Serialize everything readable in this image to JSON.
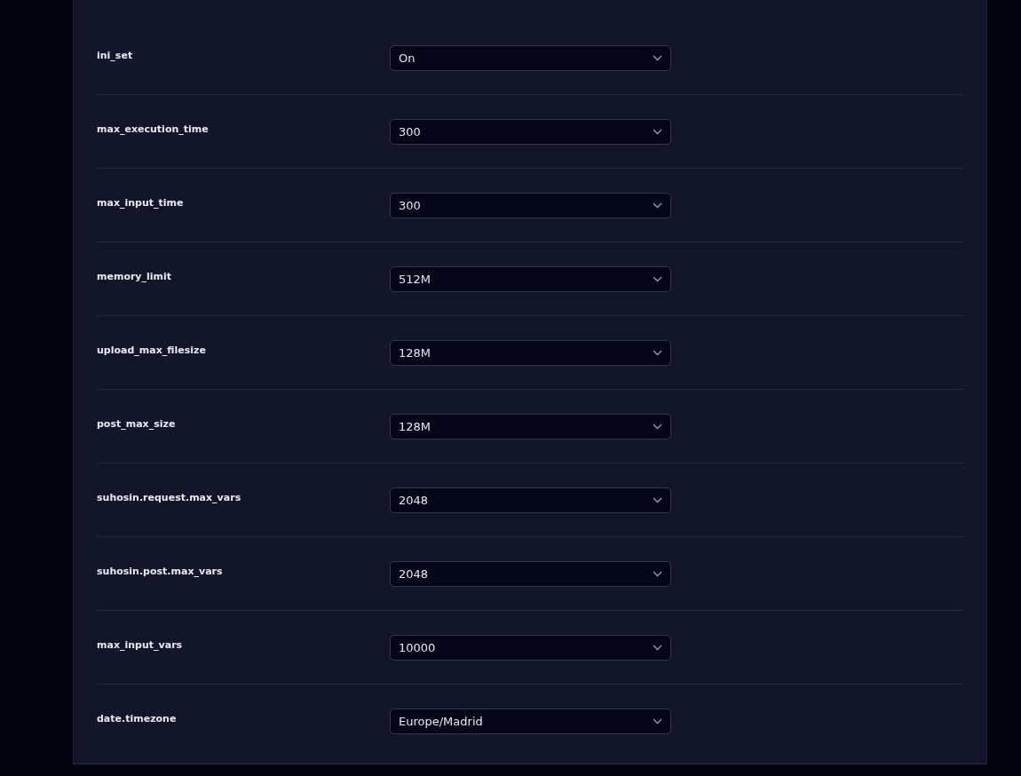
{
  "settings": [
    {
      "label": "ini_set",
      "value": "On"
    },
    {
      "label": "max_execution_time",
      "value": "300"
    },
    {
      "label": "max_input_time",
      "value": "300"
    },
    {
      "label": "memory_limit",
      "value": "512M"
    },
    {
      "label": "upload_max_filesize",
      "value": "128M"
    },
    {
      "label": "post_max_size",
      "value": "128M"
    },
    {
      "label": "suhosin.request.max_vars",
      "value": "2048"
    },
    {
      "label": "suhosin.post.max_vars",
      "value": "2048"
    },
    {
      "label": "max_input_vars",
      "value": "10000"
    },
    {
      "label": "date.timezone",
      "value": "Europe/Madrid"
    }
  ]
}
